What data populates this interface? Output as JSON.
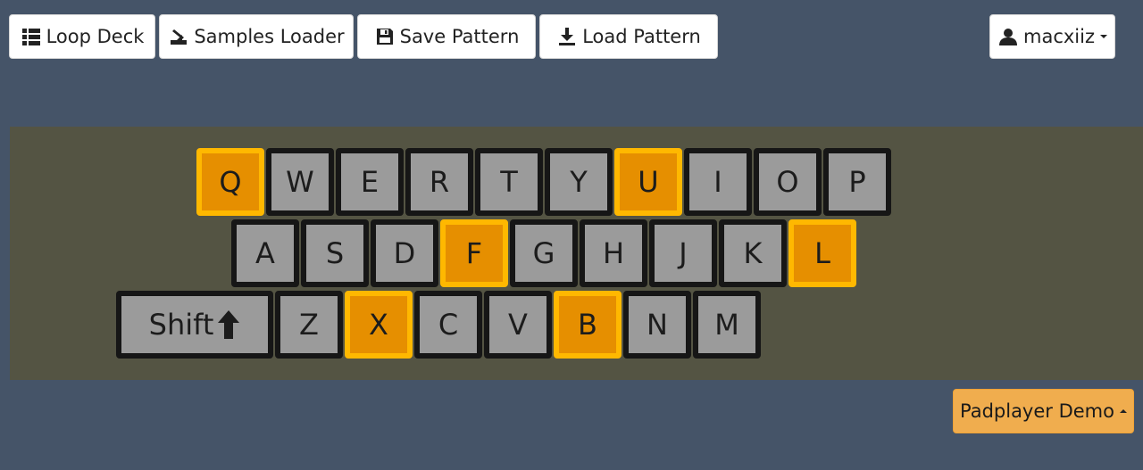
{
  "toolbar": {
    "loop_deck": "Loop Deck",
    "samples_loader": "Samples Loader",
    "save_pattern": "Save Pattern",
    "load_pattern": "Load Pattern"
  },
  "user": {
    "name": "macxiiz"
  },
  "keyboard": {
    "row1": [
      {
        "label": "Q",
        "active": true
      },
      {
        "label": "W",
        "active": false
      },
      {
        "label": "E",
        "active": false
      },
      {
        "label": "R",
        "active": false
      },
      {
        "label": "T",
        "active": false
      },
      {
        "label": "Y",
        "active": false
      },
      {
        "label": "U",
        "active": true
      },
      {
        "label": "I",
        "active": false
      },
      {
        "label": "O",
        "active": false
      },
      {
        "label": "P",
        "active": false
      }
    ],
    "row2": [
      {
        "label": "A",
        "active": false
      },
      {
        "label": "S",
        "active": false
      },
      {
        "label": "D",
        "active": false
      },
      {
        "label": "F",
        "active": true
      },
      {
        "label": "G",
        "active": false
      },
      {
        "label": "H",
        "active": false
      },
      {
        "label": "J",
        "active": false
      },
      {
        "label": "K",
        "active": false
      },
      {
        "label": "L",
        "active": true
      }
    ],
    "row3": [
      {
        "label": "Shift",
        "active": false
      },
      {
        "label": "Z",
        "active": false
      },
      {
        "label": "X",
        "active": true
      },
      {
        "label": "C",
        "active": false
      },
      {
        "label": "V",
        "active": false
      },
      {
        "label": "B",
        "active": true
      },
      {
        "label": "N",
        "active": false
      },
      {
        "label": "M",
        "active": false
      }
    ]
  },
  "demo": {
    "label": "Padplayer Demo"
  },
  "colors": {
    "background": "#455468",
    "stage": "#545443",
    "key_idle": "#9b9b9b",
    "key_active": "#e68f00",
    "key_active_border": "#ffb800",
    "demo_button": "#f0ad4e"
  }
}
